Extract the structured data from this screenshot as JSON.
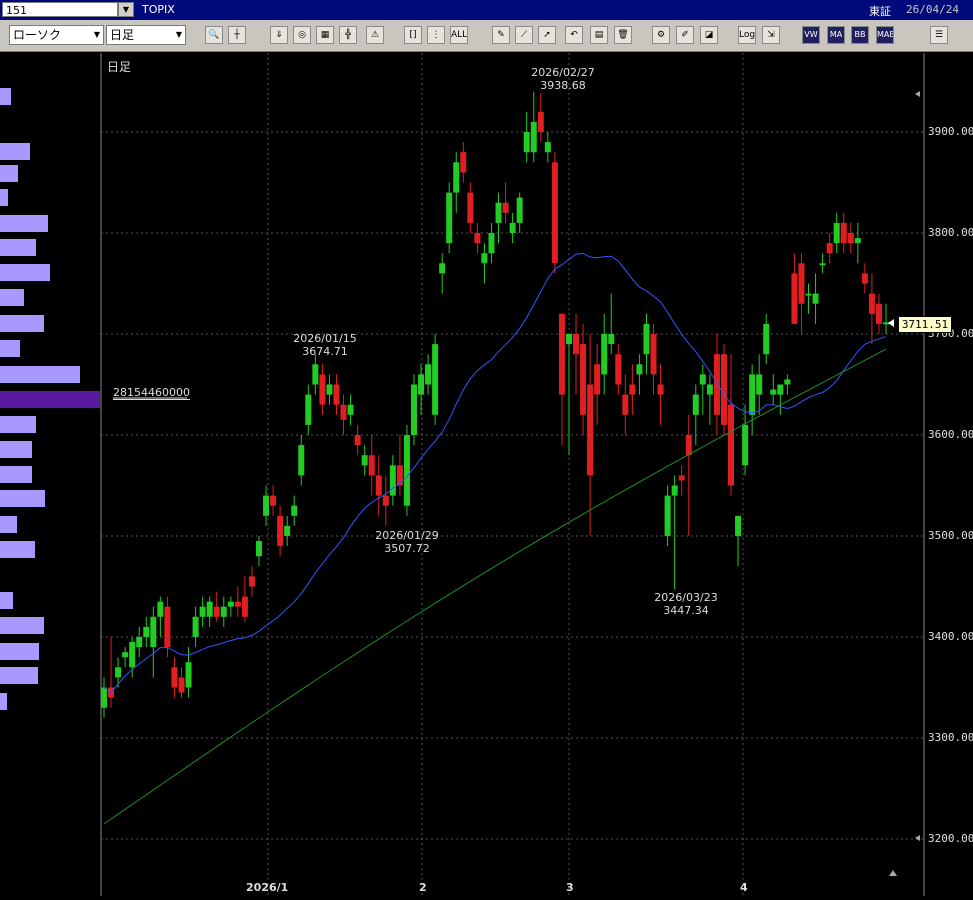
{
  "header": {
    "code": "151",
    "title": "TOPIX",
    "market": "東証",
    "date": "26/04/24"
  },
  "toolbar": {
    "chart_type": "ローソク",
    "period": "日足",
    "buttons": [
      {
        "name": "zoom-icon",
        "glyph": "🔍"
      },
      {
        "name": "crosshair-icon",
        "glyph": "┼"
      },
      {
        "name": "download-icon",
        "glyph": "⇓"
      },
      {
        "name": "inspect-icon",
        "glyph": "◎"
      },
      {
        "name": "grid-icon",
        "glyph": "▦"
      },
      {
        "name": "candle-icon",
        "glyph": "╬"
      },
      {
        "name": "warning-icon",
        "glyph": "⚠"
      },
      {
        "name": "bracket-icon",
        "glyph": "[]"
      },
      {
        "name": "compare-icon",
        "glyph": "⋮"
      },
      {
        "name": "all-icon",
        "glyph": "ALL"
      },
      {
        "name": "pencil-icon",
        "glyph": "✎"
      },
      {
        "name": "line-tool-icon",
        "glyph": "⟋"
      },
      {
        "name": "pointer-icon",
        "glyph": "➚"
      },
      {
        "name": "undo-icon",
        "glyph": "↶"
      },
      {
        "name": "note-icon",
        "glyph": "▤"
      },
      {
        "name": "trash-icon",
        "glyph": "🗑"
      },
      {
        "name": "settings-icon",
        "glyph": "⚙"
      },
      {
        "name": "brush-icon",
        "glyph": "✐"
      },
      {
        "name": "color-icon",
        "glyph": "◪"
      },
      {
        "name": "log-icon",
        "glyph": "Log"
      },
      {
        "name": "export-icon",
        "glyph": "⇲"
      },
      {
        "name": "vwap-icon",
        "glyph": "VW"
      },
      {
        "name": "ma-icon",
        "glyph": "MA"
      },
      {
        "name": "bb-icon",
        "glyph": "BB"
      },
      {
        "name": "mae-icon",
        "glyph": "MAE"
      },
      {
        "name": "list-icon",
        "glyph": "☰"
      }
    ]
  },
  "chart": {
    "period_label": "日足",
    "current_price": "3711.51",
    "volume_label": "28154460000",
    "y_ticks": [
      "3900.00",
      "3800.00",
      "3700.00",
      "3600.00",
      "3500.00",
      "3400.00",
      "3300.00",
      "3200.00"
    ],
    "x_ticks": [
      "2026/1",
      "2",
      "3",
      "4"
    ],
    "annotations": [
      {
        "date": "2026/02/27",
        "value": "3938.68"
      },
      {
        "date": "2026/01/15",
        "value": "3674.71"
      },
      {
        "date": "2026/01/29",
        "value": "3507.72"
      },
      {
        "date": "2026/03/23",
        "value": "3447.34"
      }
    ],
    "colors": {
      "up": "#22cc22",
      "down": "#e02020",
      "ma_short": "#3355ff",
      "ma_long": "#1f8f1f",
      "volume": "#a899ff",
      "volume_hl": "#5a1aa0",
      "grid": "#555"
    }
  },
  "chart_data": {
    "type": "candlestick",
    "ylim": [
      3200,
      3960
    ],
    "candles": [
      [
        3330,
        3360,
        3320,
        3350
      ],
      [
        3350,
        3400,
        3330,
        3340
      ],
      [
        3360,
        3380,
        3350,
        3370
      ],
      [
        3380,
        3390,
        3370,
        3385
      ],
      [
        3370,
        3400,
        3360,
        3395
      ],
      [
        3390,
        3410,
        3380,
        3400
      ],
      [
        3400,
        3420,
        3390,
        3410
      ],
      [
        3390,
        3430,
        3360,
        3420
      ],
      [
        3420,
        3440,
        3400,
        3435
      ],
      [
        3430,
        3440,
        3380,
        3390
      ],
      [
        3370,
        3380,
        3340,
        3350
      ],
      [
        3360,
        3370,
        3340,
        3345
      ],
      [
        3350,
        3390,
        3340,
        3375
      ],
      [
        3400,
        3430,
        3390,
        3420
      ],
      [
        3420,
        3440,
        3410,
        3430
      ],
      [
        3420,
        3440,
        3410,
        3435
      ],
      [
        3430,
        3445,
        3415,
        3420
      ],
      [
        3420,
        3440,
        3410,
        3430
      ],
      [
        3430,
        3440,
        3420,
        3435
      ],
      [
        3435,
        3450,
        3420,
        3430
      ],
      [
        3440,
        3460,
        3415,
        3420
      ],
      [
        3460,
        3470,
        3440,
        3450
      ],
      [
        3480,
        3500,
        3470,
        3495
      ],
      [
        3520,
        3550,
        3510,
        3540
      ],
      [
        3540,
        3550,
        3520,
        3530
      ],
      [
        3520,
        3530,
        3480,
        3490
      ],
      [
        3500,
        3520,
        3490,
        3510
      ],
      [
        3520,
        3540,
        3510,
        3530
      ],
      [
        3560,
        3600,
        3550,
        3590
      ],
      [
        3610,
        3650,
        3600,
        3640
      ],
      [
        3650,
        3680,
        3640,
        3670
      ],
      [
        3660,
        3670,
        3620,
        3630
      ],
      [
        3640,
        3660,
        3630,
        3650
      ],
      [
        3650,
        3660,
        3620,
        3630
      ],
      [
        3630,
        3640,
        3600,
        3615
      ],
      [
        3620,
        3640,
        3610,
        3630
      ],
      [
        3600,
        3610,
        3580,
        3590
      ],
      [
        3570,
        3590,
        3560,
        3580
      ],
      [
        3580,
        3600,
        3540,
        3560
      ],
      [
        3560,
        3580,
        3520,
        3540
      ],
      [
        3540,
        3560,
        3510,
        3530
      ],
      [
        3540,
        3580,
        3530,
        3570
      ],
      [
        3570,
        3600,
        3540,
        3550
      ],
      [
        3530,
        3610,
        3520,
        3600
      ],
      [
        3600,
        3660,
        3590,
        3650
      ],
      [
        3640,
        3670,
        3620,
        3660
      ],
      [
        3650,
        3680,
        3640,
        3670
      ],
      [
        3620,
        3700,
        3610,
        3690
      ],
      [
        3760,
        3780,
        3740,
        3770
      ],
      [
        3790,
        3850,
        3780,
        3840
      ],
      [
        3840,
        3880,
        3820,
        3870
      ],
      [
        3880,
        3890,
        3850,
        3860
      ],
      [
        3840,
        3850,
        3800,
        3810
      ],
      [
        3800,
        3810,
        3780,
        3790
      ],
      [
        3770,
        3790,
        3750,
        3780
      ],
      [
        3780,
        3810,
        3770,
        3800
      ],
      [
        3810,
        3840,
        3790,
        3830
      ],
      [
        3830,
        3850,
        3810,
        3820
      ],
      [
        3800,
        3820,
        3790,
        3810
      ],
      [
        3810,
        3840,
        3800,
        3835
      ],
      [
        3880,
        3920,
        3870,
        3900
      ],
      [
        3880,
        3940,
        3870,
        3910
      ],
      [
        3920,
        3938.68,
        3890,
        3900
      ],
      [
        3880,
        3900,
        3870,
        3890
      ],
      [
        3870,
        3880,
        3760,
        3770
      ],
      [
        3720,
        3720,
        3590,
        3640
      ],
      [
        3690,
        3700,
        3580,
        3700
      ],
      [
        3700,
        3720,
        3640,
        3680
      ],
      [
        3690,
        3710,
        3600,
        3620
      ],
      [
        3650,
        3700,
        3500,
        3560
      ],
      [
        3670,
        3690,
        3610,
        3640
      ],
      [
        3660,
        3720,
        3640,
        3700
      ],
      [
        3690,
        3740,
        3680,
        3700
      ],
      [
        3680,
        3690,
        3640,
        3650
      ],
      [
        3640,
        3660,
        3600,
        3620
      ],
      [
        3650,
        3670,
        3620,
        3640
      ],
      [
        3660,
        3680,
        3640,
        3670
      ],
      [
        3680,
        3720,
        3660,
        3710
      ],
      [
        3700,
        3710,
        3640,
        3660
      ],
      [
        3650,
        3670,
        3610,
        3640
      ],
      [
        3500,
        3550,
        3490,
        3540
      ],
      [
        3540,
        3560,
        3447.34,
        3550
      ],
      [
        3560,
        3570,
        3540,
        3555
      ],
      [
        3600,
        3620,
        3500,
        3580
      ],
      [
        3620,
        3650,
        3590,
        3640
      ],
      [
        3650,
        3670,
        3620,
        3660
      ],
      [
        3640,
        3660,
        3610,
        3650
      ],
      [
        3680,
        3700,
        3600,
        3620
      ],
      [
        3680,
        3690,
        3600,
        3610
      ],
      [
        3630,
        3680,
        3540,
        3550
      ],
      [
        3500,
        3510,
        3470,
        3520
      ],
      [
        3570,
        3630,
        3560,
        3610
      ],
      [
        3620,
        3670,
        3600,
        3660
      ],
      [
        3640,
        3680,
        3620,
        3660
      ],
      [
        3680,
        3720,
        3670,
        3710
      ],
      [
        3640,
        3660,
        3630,
        3645
      ],
      [
        3640,
        3650,
        3620,
        3650
      ],
      [
        3650,
        3660,
        3640,
        3655
      ],
      [
        3760,
        3780,
        3710,
        3710
      ],
      [
        3770,
        3780,
        3700,
        3730
      ],
      [
        3740,
        3750,
        3720,
        3740
      ],
      [
        3730,
        3760,
        3710,
        3740
      ],
      [
        3770,
        3780,
        3760,
        3770
      ],
      [
        3790,
        3800,
        3770,
        3780
      ],
      [
        3790,
        3820,
        3780,
        3810
      ],
      [
        3810,
        3820,
        3780,
        3790
      ],
      [
        3800,
        3810,
        3780,
        3790
      ],
      [
        3790,
        3810,
        3770,
        3795
      ],
      [
        3760,
        3770,
        3740,
        3750
      ],
      [
        3740,
        3760,
        3690,
        3720
      ],
      [
        3730,
        3740,
        3700,
        3710
      ],
      [
        3711.51,
        3730,
        3700,
        3711.51
      ]
    ]
  }
}
